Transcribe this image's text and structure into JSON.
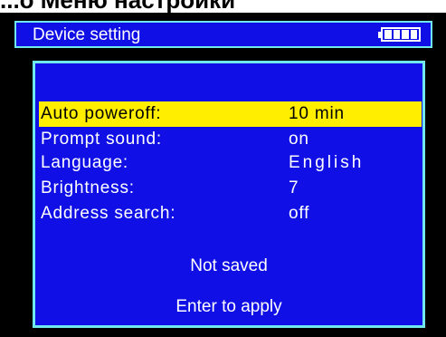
{
  "caption": "...о Меню настройки",
  "header": {
    "title": "Device setting",
    "battery_icon": "battery-full-icon"
  },
  "settings": [
    {
      "label": "Auto poweroff:",
      "value": "10 min",
      "selected": true
    },
    {
      "label": "Prompt sound:",
      "value": "on",
      "selected": false
    },
    {
      "label": "Language:",
      "value": "English",
      "selected": false
    },
    {
      "label": "Brightness:",
      "value": "7",
      "selected": false
    },
    {
      "label": "Address search:",
      "value": "off",
      "selected": false
    }
  ],
  "status": {
    "save_state": "Not saved",
    "hint": "Enter to apply"
  },
  "colors": {
    "panel_blue": "#1010e6",
    "border_cyan": "#6fe8ee",
    "highlight_yellow": "#ffee00",
    "background_black": "#000000"
  }
}
